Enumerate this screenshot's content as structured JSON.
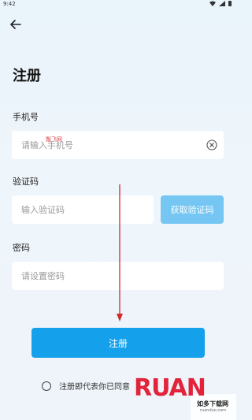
{
  "status_bar": {
    "time": "9:42"
  },
  "page": {
    "title": "注册"
  },
  "phone": {
    "label": "手机号",
    "placeholder": "请输入手机号"
  },
  "code": {
    "label": "验证码",
    "placeholder": "输入验证码",
    "button_label": "获取验证码"
  },
  "password": {
    "label": "密码",
    "placeholder": "请设置密码"
  },
  "register_button": {
    "label": "注册"
  },
  "agreement": {
    "text": "注册即代表你已同意"
  },
  "watermark": {
    "small_text": "飘飞网",
    "logo_text": "RUAN",
    "logo_subtitle": "如多下载网",
    "logo_url": "ruanduo.com"
  },
  "colors": {
    "accent": "#14a0ea",
    "code_button": "#75c6f3",
    "arrow": "#d22a2a"
  }
}
